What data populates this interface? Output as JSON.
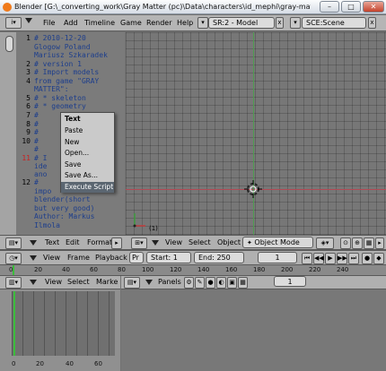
{
  "window": {
    "title": "Blender [G:\\_converting_work\\Gray Matter (pc)\\Data\\characters\\id_mephi\\gray-matter-pc-b3d-impo..."
  },
  "main_header": {
    "menus": [
      "File",
      "Add",
      "Timeline",
      "Game",
      "Render",
      "Help"
    ],
    "screen_combo": "SR:2 - Model",
    "scene_combo": "SCE:Scene"
  },
  "text_editor": {
    "line_numbers": [
      "1",
      "2",
      "3",
      "4",
      "",
      "",
      "",
      "",
      "",
      "",
      "",
      "",
      "",
      "",
      "",
      "12",
      "",
      "",
      "",
      "",
      "",
      ""
    ],
    "code_lines": [
      "# 2010-12-20",
      "Glogow Poland",
      "Mariusz Szkaradek",
      "# version 1",
      "# Import models",
      "from game \"GRAY",
      "MATTER\":",
      "#   * skeleton",
      "#   * geometry",
      "#",
      "#",
      "#",
      "#",
      "#",
      "# I",
      "ide",
      "ano",
      "#",
      "impo",
      "blender(short",
      "but very good)",
      "Author: Markus",
      "Ilmola"
    ],
    "header_menus": [
      "Text",
      "Edit",
      "Format"
    ]
  },
  "context_menu": {
    "items": [
      "Text",
      "Paste",
      "New",
      "Open...",
      "Save",
      "Save As...",
      "Execute Script"
    ]
  },
  "view3d_header": {
    "menus": [
      "View",
      "Select",
      "Object"
    ],
    "mode": "Object Mode",
    "frame_label": "(1)"
  },
  "timeline_header": {
    "menus": [
      "View",
      "Frame",
      "Playback"
    ],
    "pr_label": "Pr",
    "start": "Start: 1",
    "end": "End: 250",
    "current_frame": "1"
  },
  "timeline_ticks": [
    "0",
    "20",
    "40",
    "60",
    "80",
    "100",
    "120",
    "140",
    "160",
    "180",
    "200",
    "220",
    "240"
  ],
  "ipo_header": {
    "menus": [
      "View",
      "Select",
      "Marke"
    ]
  },
  "ipo_ticks": [
    "0",
    "20",
    "40",
    "60"
  ],
  "buttons_header": {
    "panels_label": "Panels",
    "page_value": "1"
  },
  "colors": {
    "xaxis": "#b24a55",
    "yaxis": "#4f9a4f",
    "menu_highlight": "#5b6671"
  }
}
